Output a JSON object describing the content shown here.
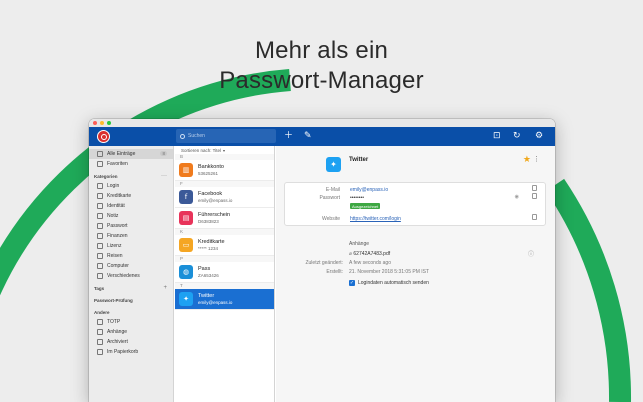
{
  "hero": {
    "line1": "Mehr als ein",
    "line2": "Passwort-Manager"
  },
  "colors": {
    "toolbar": "#0a4fa8",
    "accent": "#1a6fd2",
    "decor_arc": "#1faa59",
    "star": "#f0a81c"
  },
  "toolbar": {
    "search_placeholder": "Suchen",
    "icons": [
      "add-icon",
      "edit-icon",
      "lock-icon",
      "sync-icon",
      "settings-icon"
    ]
  },
  "sidebar": {
    "top": [
      {
        "label": "Alle Einträge",
        "count": "8",
        "icon": "list-icon"
      },
      {
        "label": "Favoriten",
        "icon": "star-icon"
      }
    ],
    "categories_title": "Kategorien",
    "categories": [
      {
        "label": "Login",
        "icon": "globe-icon"
      },
      {
        "label": "Kreditkarte",
        "icon": "credit-card-icon"
      },
      {
        "label": "Identität",
        "icon": "id-icon"
      },
      {
        "label": "Notiz",
        "icon": "note-icon"
      },
      {
        "label": "Passwort",
        "icon": "key-icon"
      },
      {
        "label": "Finanzen",
        "icon": "bank-icon"
      },
      {
        "label": "Lizenz",
        "icon": "license-icon"
      },
      {
        "label": "Reisen",
        "icon": "travel-icon"
      },
      {
        "label": "Computer",
        "icon": "computer-icon"
      },
      {
        "label": "Verschiedenes",
        "icon": "misc-icon"
      }
    ],
    "tags_title": "Tags",
    "audit_title": "Passwort-Prüfung",
    "other_title": "Andere",
    "other": [
      {
        "label": "TOTP",
        "icon": "clock-icon"
      },
      {
        "label": "Anhänge",
        "icon": "paperclip-icon"
      },
      {
        "label": "Archiviert",
        "icon": "archive-icon"
      },
      {
        "label": "Im Papierkorb",
        "icon": "trash-icon"
      }
    ]
  },
  "list": {
    "sort_label": "Sortieren nach: Titel",
    "groups": [
      {
        "letter": "B",
        "items": [
          {
            "title": "Bankkonto",
            "subtitle": "53625261",
            "icon": "bank-icon",
            "color": "#f07b1d",
            "glyph": "▥"
          }
        ]
      },
      {
        "letter": "F",
        "items": [
          {
            "title": "Facebook",
            "subtitle": "emily@enpass.io",
            "icon": "facebook-icon",
            "color": "#3b5998",
            "glyph": "f"
          },
          {
            "title": "Führerschein",
            "subtitle": "D6383823",
            "icon": "license-card-icon",
            "color": "#e8335a",
            "glyph": "▤"
          }
        ]
      },
      {
        "letter": "K",
        "items": [
          {
            "title": "Kreditkarte",
            "subtitle": "***** 1234",
            "icon": "credit-card-icon",
            "color": "#f5a623",
            "glyph": "▭"
          }
        ]
      },
      {
        "letter": "P",
        "items": [
          {
            "title": "Pass",
            "subtitle": "ZA653426",
            "icon": "passport-icon",
            "color": "#1a8fd8",
            "glyph": "◍"
          }
        ]
      },
      {
        "letter": "T",
        "items": [
          {
            "title": "Twitter",
            "subtitle": "emily@enpass.io",
            "icon": "twitter-icon",
            "color": "#1da1f2",
            "glyph": "✦"
          }
        ]
      }
    ]
  },
  "detail": {
    "title": "Twitter",
    "fields": [
      {
        "label": "E-Mail",
        "value": "emily@enpass.io"
      },
      {
        "label": "Passwort",
        "value": "••••••••",
        "badge": "Ausgezeichnet"
      },
      {
        "label": "Website",
        "value": "https://twitter.com/login"
      }
    ],
    "attachments_title": "Anhänge",
    "attachment": "62742A7483.pdf",
    "modified_label": "Zuletzt geändert:",
    "modified_value": "A few seconds ago",
    "created_label": "Erstellt:",
    "created_value": "21. November 2018 5:31:05 PM IST",
    "autosubmit_label": "Logindaten automatisch senden"
  }
}
